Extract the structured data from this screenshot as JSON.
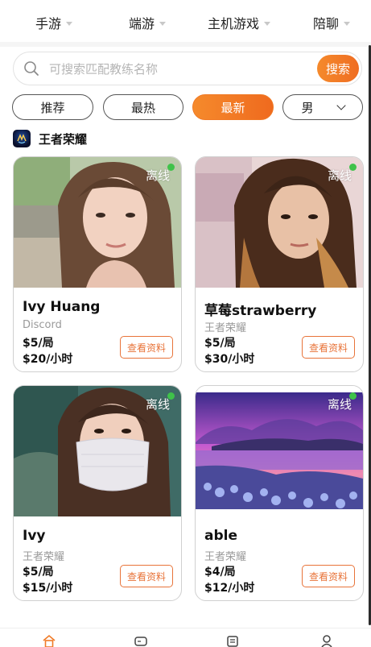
{
  "top_tabs": [
    {
      "label": "手游"
    },
    {
      "label": "端游"
    },
    {
      "label": "主机游戏"
    },
    {
      "label": "陪聊"
    }
  ],
  "search": {
    "placeholder": "可搜索匹配教练名称",
    "button_label": "搜索"
  },
  "filters": [
    {
      "label": "推荐",
      "active": false
    },
    {
      "label": "最热",
      "active": false
    },
    {
      "label": "最新",
      "active": true
    },
    {
      "label": "男",
      "dropdown": true
    }
  ],
  "section": {
    "title": "王者荣耀",
    "icon": "honor-of-kings-logo"
  },
  "cards": [
    {
      "status": "离线",
      "name": "Ivy Huang",
      "game": "Discord",
      "price_round": "$5/局",
      "price_hour": "$20/小时",
      "button": "查看资料"
    },
    {
      "status": "离线",
      "name": "草莓strawberry",
      "game": "王者荣耀",
      "price_round": "$5/局",
      "price_hour": "$30/小时",
      "button": "查看资料"
    },
    {
      "status": "离线",
      "name": "Ivy",
      "game": "王者荣耀",
      "price_round": "$5/局",
      "price_hour": "$15/小时",
      "button": "查看资料"
    },
    {
      "status": "离线",
      "name": "able",
      "game": "王者荣耀",
      "price_round": "$4/局",
      "price_hour": "$12/小时",
      "button": "查看资料"
    }
  ],
  "bottom_nav": [
    {
      "icon": "home-icon",
      "active": true
    },
    {
      "icon": "game-icon",
      "active": false
    },
    {
      "icon": "message-icon",
      "active": false
    },
    {
      "icon": "profile-icon",
      "active": false
    }
  ],
  "colors": {
    "accent": "#f07a26",
    "online_dot": "#3fc24a",
    "muted_text": "#9a9a9a"
  }
}
